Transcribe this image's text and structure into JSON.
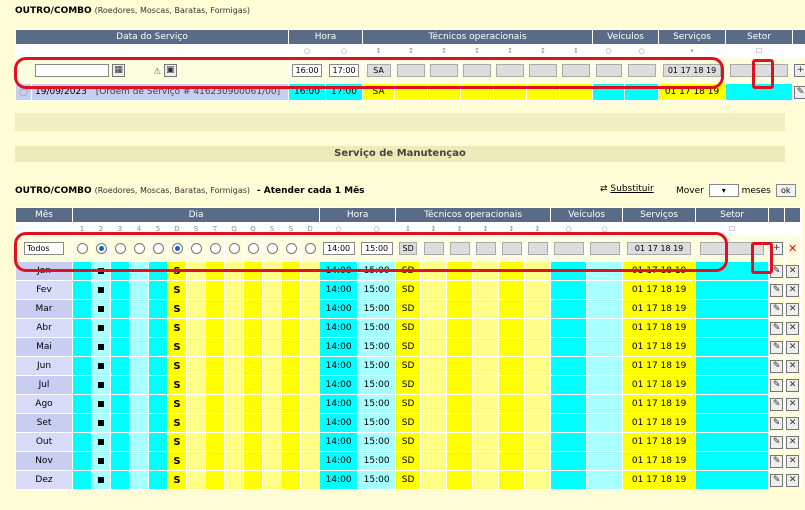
{
  "top": {
    "header_bold": "OUTRO/COMBO",
    "header_sub": "(Roedores, Moscas, Baratas, Formigas)",
    "columns": {
      "data": "Data do Serviço",
      "hora": "Hora",
      "tecnicos": "Técnicos operacionais",
      "veiculos": "Veículos",
      "servicos": "Serviços",
      "setor": "Setor"
    },
    "input_row": {
      "hora_inicio": "16:00",
      "hora_fim": "17:00",
      "tecnico": "SA",
      "servicos": "01 17 18 19"
    },
    "row": {
      "date": "19/09/2023",
      "order": "[Ordem de Serviço # 416230900061/00]",
      "hora_inicio": "16:00",
      "hora_fim": "17:00",
      "tecnico": "SA",
      "servicos": "01 17 18 19"
    }
  },
  "section_title": "Serviço de Manutençao",
  "bottom": {
    "header_bold": "OUTRO/COMBO",
    "header_sub": "(Roedores, Moscas, Baratas, Formigas)",
    "header_extra": "- Atender cada 1 Mês",
    "substituir": "Substituir",
    "mover": "Mover",
    "meses": "meses",
    "ok": "ok",
    "columns": {
      "mes": "Mês",
      "dia": "Dia",
      "hora": "Hora",
      "tecnicos": "Técnicos operacionais",
      "veiculos": "Veículos",
      "servicos": "Serviços",
      "setor": "Setor"
    },
    "day_letters": [
      "1",
      "2",
      "3",
      "4",
      "5",
      "U",
      "D",
      "S",
      "T",
      "Q",
      "Q",
      "S",
      "S",
      "D"
    ],
    "input_row": {
      "mes_select": "Todos",
      "hora_inicio": "14:00",
      "hora_fim": "15:00",
      "tecnico": "SD",
      "servicos": "01 17 18 19"
    },
    "months": [
      "Jan",
      "Fev",
      "Mar",
      "Abr",
      "Mai",
      "Jun",
      "Jul",
      "Ago",
      "Set",
      "Out",
      "Nov",
      "Dez"
    ],
    "row_values": {
      "day_letter": "S",
      "hora_inicio": "14:00",
      "hora_fim": "15:00",
      "tecnico": "SD",
      "servicos": "01 17 18 19"
    }
  },
  "colors": {
    "header": "#5a6b88",
    "cyan": "#00ffff",
    "yellow": "#ffff00",
    "highlight": "#e01020",
    "background": "#fffdd6"
  }
}
